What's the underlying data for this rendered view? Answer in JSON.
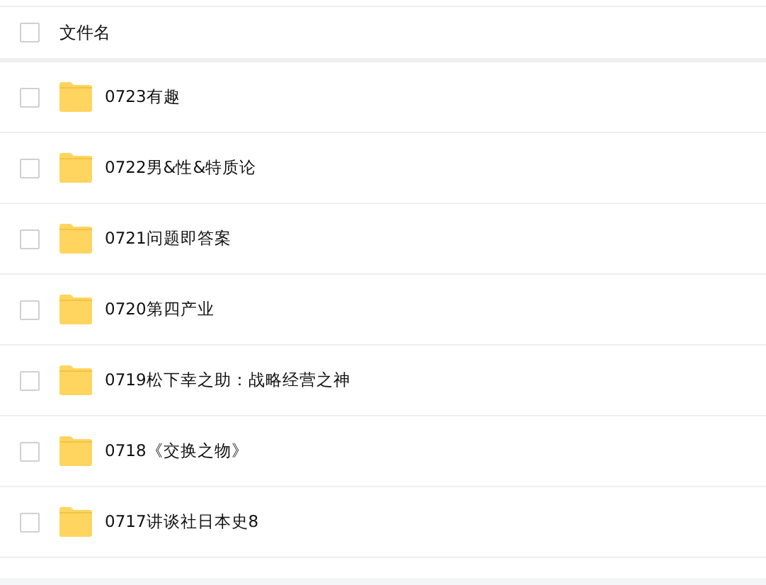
{
  "header": {
    "label": "文件名",
    "checked": false
  },
  "files": [
    {
      "name": "0723有趣",
      "checked": false
    },
    {
      "name": "0722男&性&特质论",
      "checked": false
    },
    {
      "name": "0721问题即答案",
      "checked": false
    },
    {
      "name": "0720第四产业",
      "checked": false
    },
    {
      "name": "0719松下幸之助：战略经营之神",
      "checked": false
    },
    {
      "name": "0718《交换之物》",
      "checked": false
    },
    {
      "name": "0717讲谈社日本史8",
      "checked": false
    }
  ]
}
